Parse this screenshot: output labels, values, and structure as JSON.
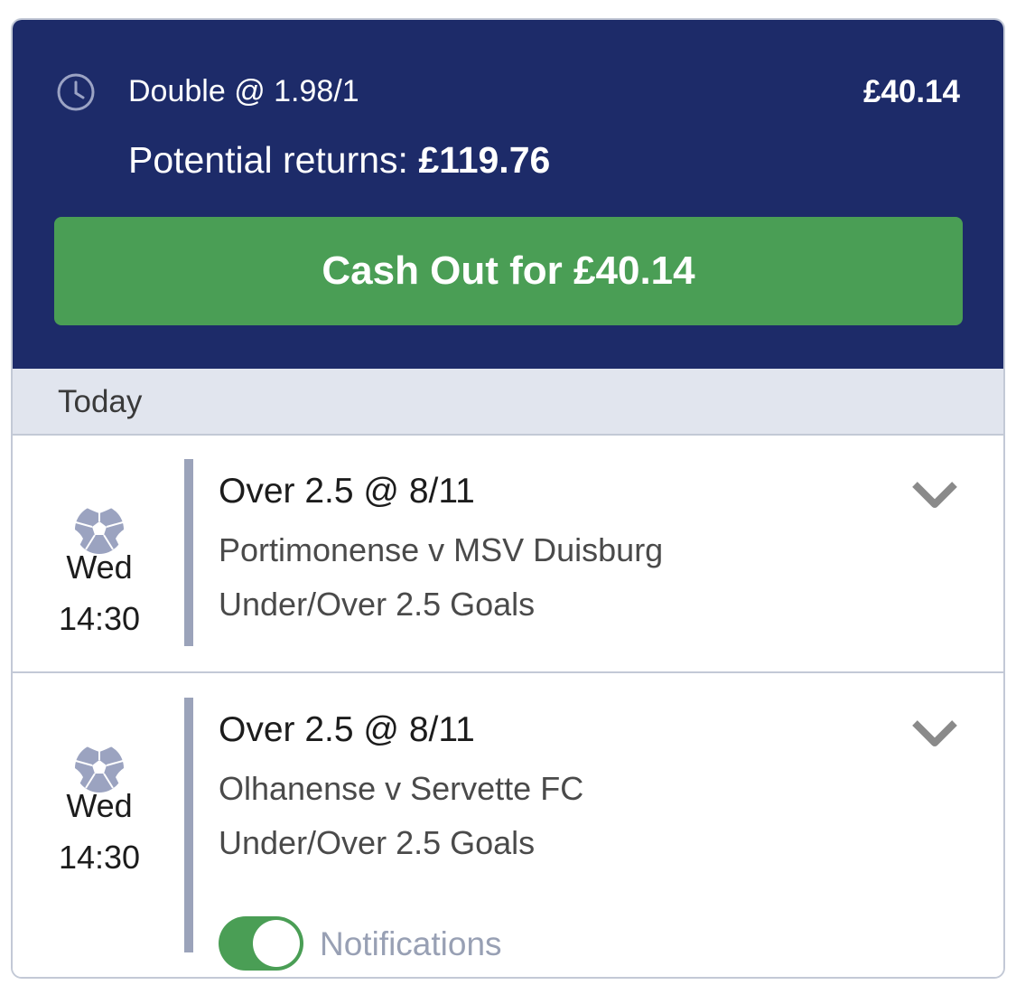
{
  "header": {
    "bet_type": "Double @ 1.98/1",
    "stake": "£40.14",
    "potential_label": "Potential returns:",
    "potential_value": "£119.76",
    "cashout_label": "Cash Out for £40.14"
  },
  "section": {
    "label": "Today"
  },
  "legs": [
    {
      "sport_icon": "football-icon",
      "day": "Wed",
      "time": "14:30",
      "selection": "Over 2.5 @ 8/11",
      "event": "Portimonense v MSV Duisburg",
      "market": "Under/Over 2.5 Goals"
    },
    {
      "sport_icon": "football-icon",
      "day": "Wed",
      "time": "14:30",
      "selection": "Over 2.5 @ 8/11",
      "event": "Olhanense v Servette FC",
      "market": "Under/Over 2.5 Goals",
      "notifications_label": "Notifications",
      "notifications_on": true
    }
  ],
  "colors": {
    "header_bg": "#1d2b69",
    "cashout_green": "#4a9e55",
    "section_bg": "#e1e5ee",
    "divider": "#9ba3ba"
  }
}
